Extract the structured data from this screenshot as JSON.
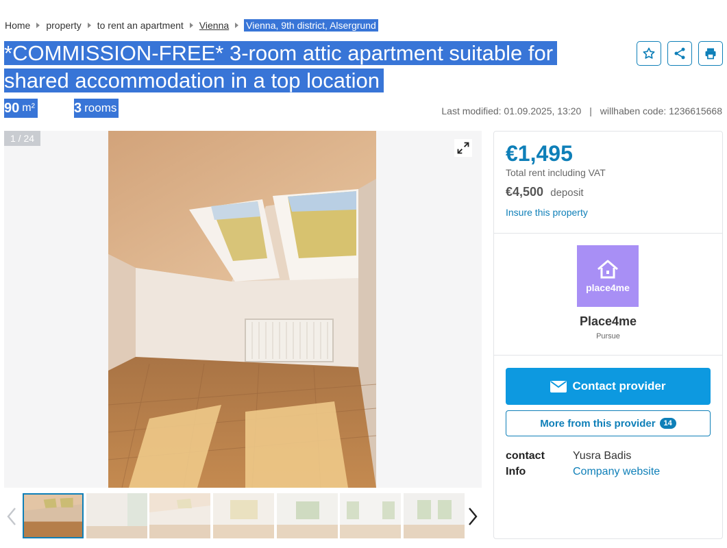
{
  "breadcrumb": [
    "Home",
    "property",
    "to rent an apartment",
    "Vienna",
    "Vienna, 9th district, Alsergrund"
  ],
  "title": "*COMMISSION-FREE* 3-room attic apartment suitable for shared accommodation in a top location",
  "facts": {
    "area_value": "90",
    "area_unit": "m²",
    "rooms_value": "3",
    "rooms_unit": "rooms"
  },
  "meta": {
    "last_modified": "Last modified: 01.09.2025, 13:20",
    "separator": "|",
    "code": "willhaben code: 1236615668"
  },
  "actions": {
    "icons": [
      "star-icon",
      "share-icon",
      "print-icon"
    ]
  },
  "gallery": {
    "counter": "1 / 24",
    "thumbnails_visible": 7,
    "active_thumbnail": 1
  },
  "panel": {
    "price": "€1,495",
    "rent_label": "Total rent including VAT",
    "deposit_value": "€4,500",
    "deposit_label": "deposit",
    "insure": "Insure this property",
    "logo_text": "place4me",
    "provider_name": "Place4me",
    "provider_sub": "Pursue",
    "contact_button": "Contact provider",
    "more_button": "More from this provider",
    "more_count": "14",
    "contact_key": "contact",
    "contact_value": "Yusra Badis",
    "info_key": "Info",
    "info_value": "Company website"
  },
  "colors": {
    "accent": "#0e7fb8",
    "selection": "#3875d7",
    "cta": "#0d99e0",
    "logo_bg": "#a88ff5"
  }
}
